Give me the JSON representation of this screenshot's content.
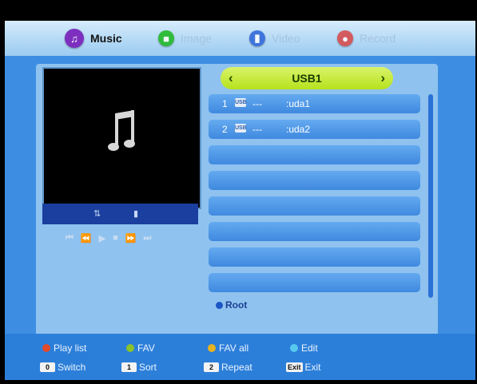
{
  "tabs": [
    {
      "label": "Music",
      "icon": "music-note-icon",
      "active": true,
      "color": "#7d2fbf"
    },
    {
      "label": "Image",
      "icon": "image-icon",
      "active": false,
      "color": "#19b61c"
    },
    {
      "label": "Video",
      "icon": "video-icon",
      "active": false,
      "color": "#2b63d8"
    },
    {
      "label": "Record",
      "icon": "record-icon",
      "active": false,
      "color": "#d84545"
    }
  ],
  "preview": {
    "icon": "music-note-icon",
    "status_icons": [
      "repeat-icon",
      "folder-icon"
    ],
    "controls": [
      "⏮",
      "⏪",
      "▶",
      "■",
      "⏩",
      "⏭"
    ]
  },
  "device": {
    "title": "USB1",
    "left_arrow": "‹",
    "right_arrow": "›"
  },
  "files": [
    {
      "num": "1",
      "dots": "---",
      "name": ":uda1"
    },
    {
      "num": "2",
      "dots": "---",
      "name": ":uda2"
    }
  ],
  "root": {
    "label": "Root"
  },
  "footer": {
    "color_keys": [
      {
        "label": "Play list",
        "color": "#e24a2b"
      },
      {
        "label": "FAV",
        "color": "#8ac22a"
      },
      {
        "label": "FAV all",
        "color": "#e6b21f"
      },
      {
        "label": "Edit",
        "color": "#57c9ef"
      }
    ],
    "num_keys": [
      {
        "key": "0",
        "label": "Switch"
      },
      {
        "key": "1",
        "label": "Sort"
      },
      {
        "key": "2",
        "label": "Repeat"
      },
      {
        "key": "Exit",
        "label": "Exit"
      }
    ]
  }
}
